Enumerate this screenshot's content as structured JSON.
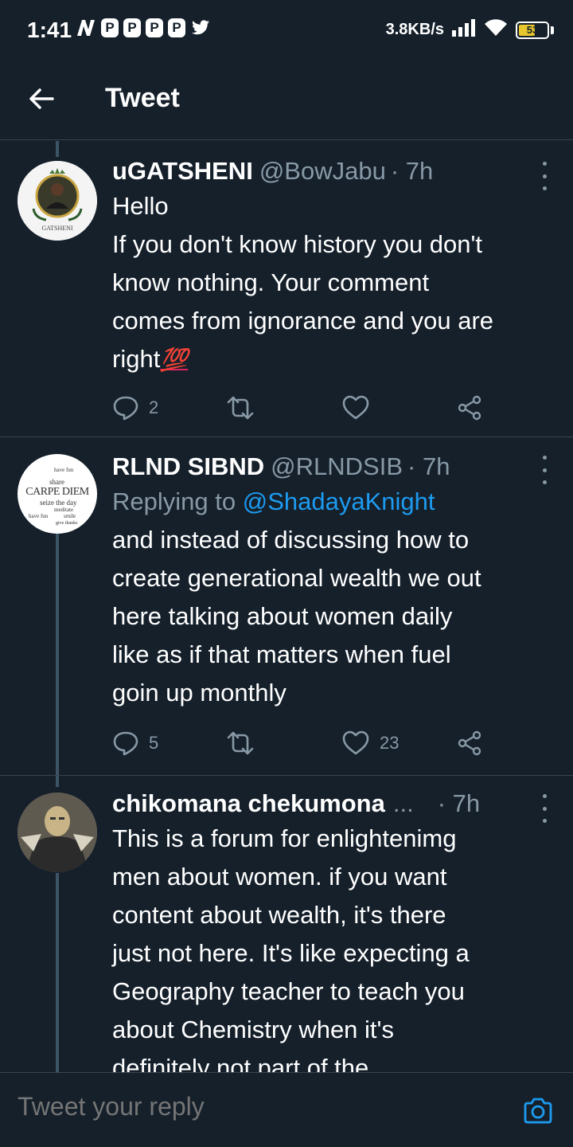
{
  "status_bar": {
    "time": "1:41",
    "notification_icons": [
      "n-icon",
      "p-icon",
      "p-icon",
      "p-icon",
      "p-icon",
      "twitter-bird-icon"
    ],
    "net_speed": "3.8KB/s",
    "battery_level": "53",
    "battery_color": "#e8c62e"
  },
  "header": {
    "title": "Tweet",
    "back_icon": "back-arrow-icon"
  },
  "tweets": [
    {
      "display_name": "uGATSHENI",
      "handle": "@BowJabu",
      "time": "· 7h",
      "avatar_text": "GATSHENI",
      "lines": [
        "Hello",
        "If you don't know history you don't",
        "know nothing. Your comment",
        "comes from ignorance and you are",
        "right"
      ],
      "emoji": "💯",
      "replies": "2",
      "retweets": "",
      "likes": ""
    },
    {
      "display_name": "RLND SIBND",
      "handle": "@RLNDSIB",
      "time": "· 7h",
      "avatar_text": "CARPE DIEM",
      "avatar_words": [
        "have fun",
        "share",
        "seize the day",
        "meditate",
        "have fun",
        "smile",
        "give thanks"
      ],
      "replying_prefix": "Replying to",
      "replying_to": "@ShadayaKnight",
      "lines": [
        "and instead of  discussing how to",
        "create generational wealth we out",
        "here talking about women daily",
        "like as if that matters when fuel",
        "goin up monthly"
      ],
      "replies": "5",
      "retweets": "",
      "likes": "23"
    },
    {
      "display_name": "chikomana chekumona",
      "ellipsis": "...",
      "time": "· 7h",
      "lines": [
        "This is a forum for enlightenimg",
        "men about women. if you want",
        "content about wealth, it's there",
        "just not here. It's like expecting a",
        "Geography teacher to teach you",
        "about Chemistry when it's",
        "definitely not part of the"
      ]
    }
  ],
  "composer": {
    "placeholder": "Tweet your reply",
    "camera_icon": "camera-icon"
  },
  "colors": {
    "background": "#15202b",
    "divider": "#38444d",
    "secondary_text": "#8899a6",
    "link": "#1d9bf0",
    "thread_line": "#3d5466"
  }
}
